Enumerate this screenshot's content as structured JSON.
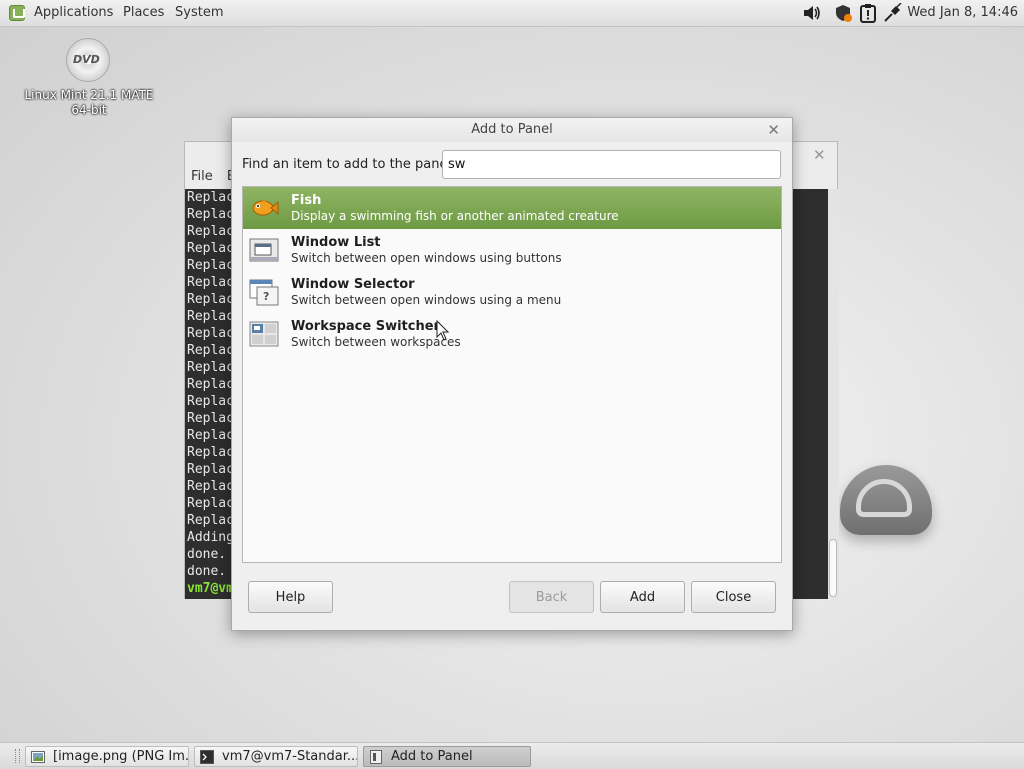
{
  "top_panel": {
    "menus": [
      "Applications",
      "Places",
      "System"
    ],
    "clock": "Wed Jan  8, 14:46",
    "tray_icons": [
      "volume-icon",
      "shield-update-icon",
      "clipboard-alert-icon",
      "network-plug-icon"
    ]
  },
  "desktop": {
    "icon_label": "Linux Mint 21.1 MATE 64-bit",
    "icon_badge": "DVD"
  },
  "terminal": {
    "menu": [
      "File",
      "E"
    ],
    "lines": [
      "Replac",
      "Replac",
      "Replac",
      "Replac",
      "Replac",
      "Replac",
      "Replac",
      "Replac",
      "Replac",
      "Replac",
      "Replac",
      "Replac",
      "Replac",
      "Replac",
      "Replac",
      "Replac",
      "Replac",
      "Replac",
      "Replac",
      "Replac",
      "Adding",
      "done.",
      "done."
    ],
    "prompt": "vm7@vm"
  },
  "dialog": {
    "title": "Add to Panel",
    "find_label": "Find an item to add to the panel:",
    "search_value": "sw",
    "items": [
      {
        "name": "Fish",
        "desc": "Display a swimming fish or another animated creature",
        "icon": "fish-icon",
        "selected": true
      },
      {
        "name": "Window List",
        "desc": "Switch between open windows using buttons",
        "icon": "window-list-icon",
        "selected": false
      },
      {
        "name": "Window Selector",
        "desc": "Switch between open windows using a menu",
        "icon": "window-selector-icon",
        "selected": false
      },
      {
        "name": "Workspace Switcher",
        "desc": "Switch between workspaces",
        "icon": "workspace-switcher-icon",
        "selected": false
      }
    ],
    "buttons": {
      "help": "Help",
      "back": "Back",
      "add": "Add",
      "close": "Close"
    }
  },
  "taskbar": {
    "tasks": [
      {
        "label": "[image.png (PNG Im...",
        "icon": "image-viewer-icon",
        "active": false
      },
      {
        "label": "vm7@vm7-Standar...",
        "icon": "terminal-icon",
        "active": false
      },
      {
        "label": "Add to Panel",
        "icon": "dialog-icon",
        "active": true
      }
    ]
  },
  "colors": {
    "selection": "#7ba550",
    "accent": "#87b158"
  }
}
